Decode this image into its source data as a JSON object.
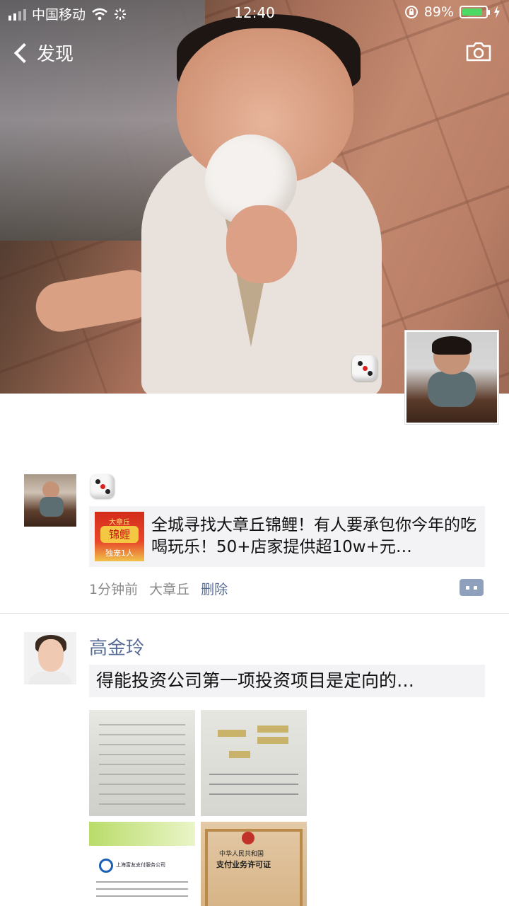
{
  "status_bar": {
    "carrier": "中国移动",
    "time": "12:40",
    "battery_percent": "89%",
    "battery_level": 0.89,
    "signal_bars": 2
  },
  "nav": {
    "back_label": "发现",
    "camera_icon": "camera-icon"
  },
  "posts": [
    {
      "share": {
        "thumb_top": "大章丘",
        "thumb_mid": "锦鲤",
        "thumb_bottom": "独宠1人",
        "text": "全城寻找大章丘锦鲤！有人要承包你今年的吃喝玩乐！50+店家提供超10w+元…"
      },
      "time": "1分钟前",
      "location": "大章丘",
      "delete_label": "删除"
    },
    {
      "name": "高金玲",
      "text": "得能投资公司第一项投资项目是定向的…",
      "photo_captions": {
        "company": "上海富友支付服务公司",
        "license_line1": "中华人民共和国",
        "license_line2": "支付业务许可证"
      }
    }
  ],
  "colors": {
    "link": "#576b95",
    "meta_gray": "#8a8a8a",
    "battery_green": "#4cd964",
    "share_bg": "#f3f3f5"
  }
}
